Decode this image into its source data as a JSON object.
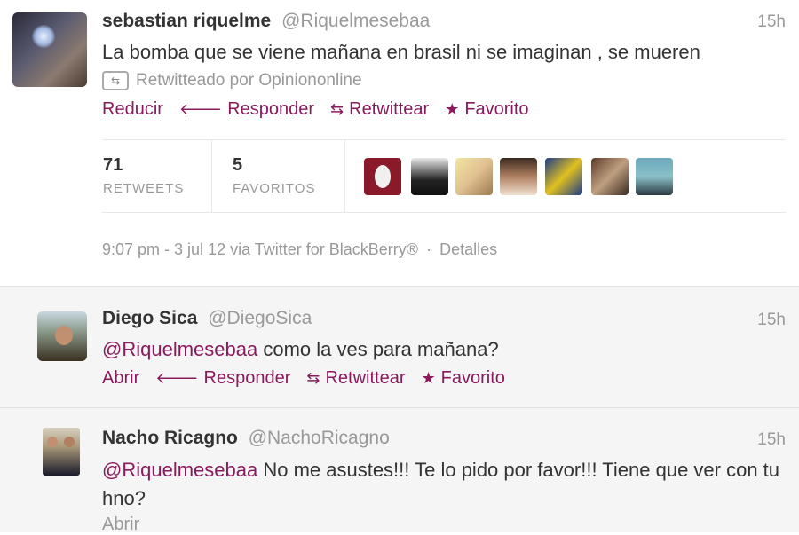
{
  "main_tweet": {
    "name": "sebastian riquelme",
    "handle": "@Riquelmesebaa",
    "time": "15h",
    "text": "La bomba que se viene mañana en brasil ni se imaginan , se mueren",
    "retweeted_by": "Retwitteado por Opiniononline",
    "actions": {
      "collapse": "Reducir",
      "reply": "Responder",
      "retweet": "Retwittear",
      "favorite": "Favorito"
    },
    "stats": {
      "retweets_count": "71",
      "retweets_label": "RETWEETS",
      "favorites_count": "5",
      "favorites_label": "FAVORITOS"
    },
    "details": {
      "timestamp": "9:07 pm - 3 jul 12 via Twitter for BlackBerry®",
      "separator": "·",
      "details_link": "Detalles"
    }
  },
  "replies": [
    {
      "name": "Diego Sica",
      "handle": "@DiegoSica",
      "time": "15h",
      "mention": "@Riquelmesebaa",
      "text": " como la ves para mañana?",
      "actions": {
        "open": "Abrir",
        "reply": "Responder",
        "retweet": "Retwittear",
        "favorite": "Favorito"
      }
    },
    {
      "name": "Nacho Ricagno",
      "handle": "@NachoRicagno",
      "time": "15h",
      "mention": "@Riquelmesebaa",
      "text": " No me asustes!!! Te lo pido por favor!!! Tiene que ver con tu hno?",
      "actions": {
        "open": "Abrir"
      }
    }
  ],
  "colors": {
    "link": "#8a1a5c",
    "muted": "#999999",
    "background": "#ffffff",
    "reply_background": "#f5f5f5"
  },
  "icons": {
    "reply": "reply-arrow-icon",
    "retweet": "retweet-icon",
    "favorite": "star-icon"
  }
}
